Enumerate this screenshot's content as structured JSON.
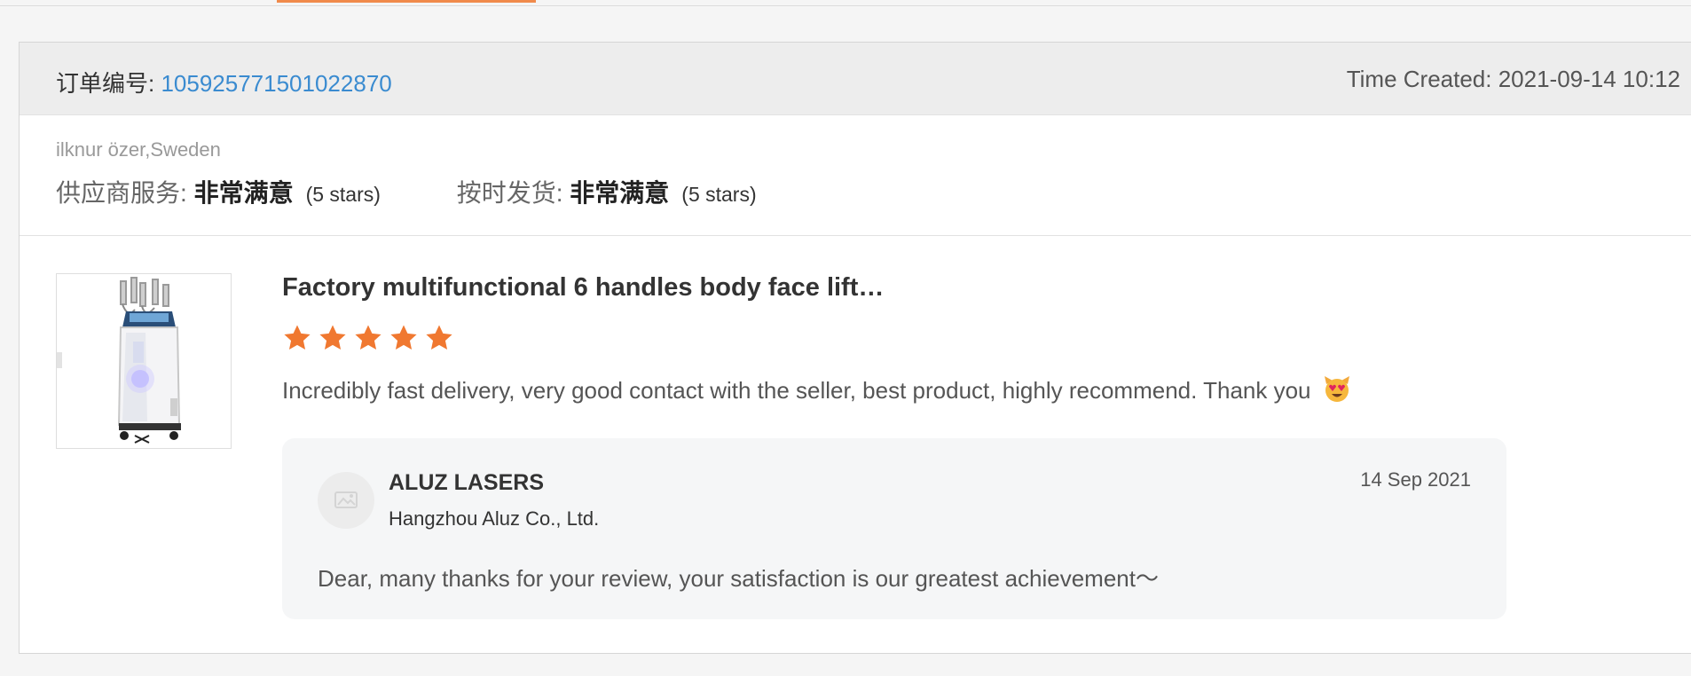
{
  "order": {
    "label": "订单编号: ",
    "number": "105925771501022870",
    "time_created": "Time Created: 2021-09-14 10:12"
  },
  "buyer": {
    "name_location": "ilknur özer,Sweden"
  },
  "ratings": [
    {
      "label": "供应商服务: ",
      "value": "非常满意",
      "stars_text": "(5 stars)"
    },
    {
      "label": "按时发货: ",
      "value": "非常满意",
      "stars_text": "(5 stars)"
    }
  ],
  "review": {
    "product_title": "Factory multifunctional 6 handles body face lift…",
    "star_rating": 5,
    "star_color": "#f07830",
    "text": "Incredibly fast delivery, very good contact with the seller, best product, highly recommend. Thank you",
    "emoji": "smiling-cat-heart-eyes-icon"
  },
  "reply": {
    "seller_name": "ALUZ LASERS",
    "company": "Hangzhou Aluz Co., Ltd.",
    "date": "14 Sep 2021",
    "text": "Dear, many thanks for your review, your satisfaction is our greatest achievement～"
  },
  "colors": {
    "accent": "#f08a4b",
    "link": "#3a8bd0"
  }
}
